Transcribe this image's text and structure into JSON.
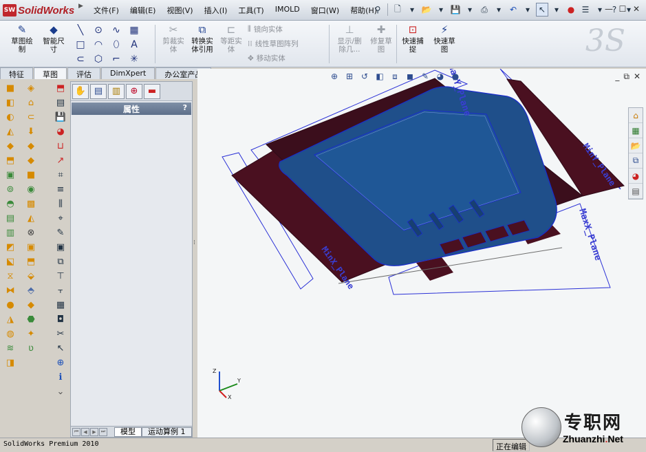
{
  "app": {
    "name": "SolidWorks",
    "logo_badge": "SW"
  },
  "menu": [
    "文件(F)",
    "编辑(E)",
    "视图(V)",
    "插入(I)",
    "工具(T)",
    "IMOLD",
    "窗口(W)",
    "帮助(H)"
  ],
  "ribbon": {
    "sketch": "草图绘\n制",
    "smart_dim": "智能尺\n寸",
    "trim": "剪裁实\n体",
    "convert": "转换实\n体引用",
    "offset": "等距实\n体",
    "mirror": "镜向实体",
    "linear_pattern": "线性草图阵列",
    "move": "移动实体",
    "show_relations": "显示/删\n除几...",
    "repair": "修复草\n图",
    "quick_snaps": "快速捕\n捉",
    "rapid_sketch": "快速草\n图"
  },
  "tabs": [
    "特征",
    "草图",
    "评估",
    "DimXpert",
    "办公室产品"
  ],
  "active_tab": "草图",
  "property_manager": {
    "header": "属性",
    "help": "?"
  },
  "bottom_tabs": [
    "模型",
    "运动算例 1"
  ],
  "viewport": {
    "plane_labels": [
      "MaxX_Plane",
      "MaxY_Plane",
      "MinX_Plane",
      "MinY_Plane"
    ],
    "axes": {
      "x": "X",
      "y": "Y",
      "z": "Z"
    },
    "colors": {
      "body": "#1f4f8a",
      "cut": "#4a1020",
      "outline": "#1a2ccc"
    }
  },
  "status": {
    "left": "SolidWorks Premium 2010",
    "right": "正在编辑"
  },
  "watermark": {
    "title": "专职网",
    "sub_a": "Zhuanzhi",
    "sub_dot": ".",
    "sub_b": "Net"
  }
}
